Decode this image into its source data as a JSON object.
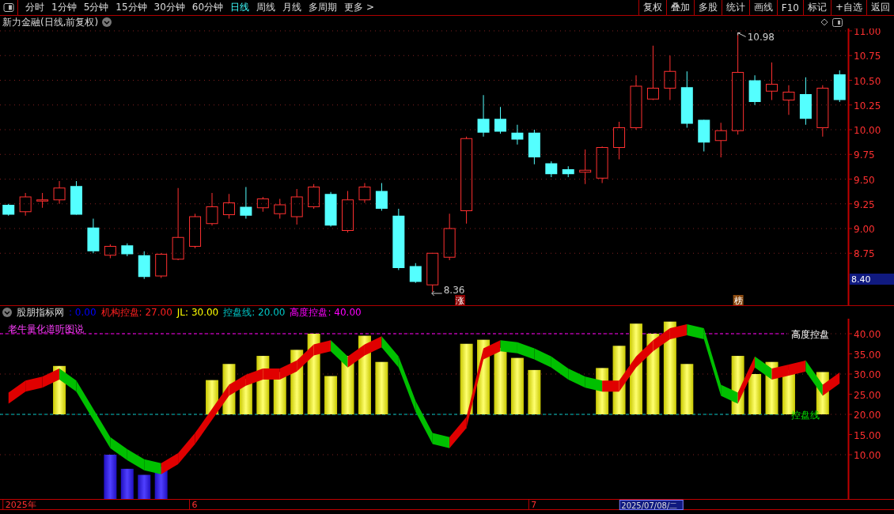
{
  "toolbar": {
    "periods": [
      {
        "label": "分时",
        "selected": false
      },
      {
        "label": "1分钟",
        "selected": false
      },
      {
        "label": "5分钟",
        "selected": false
      },
      {
        "label": "15分钟",
        "selected": false
      },
      {
        "label": "30分钟",
        "selected": false
      },
      {
        "label": "60分钟",
        "selected": false
      },
      {
        "label": "日线",
        "selected": true
      },
      {
        "label": "周线",
        "selected": false
      },
      {
        "label": "月线",
        "selected": false
      },
      {
        "label": "多周期",
        "selected": false
      },
      {
        "label": "更多 >",
        "selected": false
      }
    ],
    "buttons": [
      "复权",
      "叠加",
      "多股",
      "统计",
      "画线",
      "F10",
      "标记",
      "+自选",
      "返回"
    ]
  },
  "price_panel": {
    "title": "新力金融(日线,前复权)",
    "cursor_price": "8.40",
    "high_label": "10.98",
    "low_label": "8.36",
    "badges": [
      {
        "text": "涨",
        "color": "#8a0000"
      },
      {
        "text": "榜",
        "color": "#8a4a10"
      }
    ],
    "chart_data": {
      "type": "candlestick",
      "ylim": [
        8.224,
        11.024
      ],
      "grid": true,
      "yticks": [
        {
          "value": 11,
          "label": "11.00"
        },
        {
          "value": 10.75,
          "label": "10.75"
        },
        {
          "value": 10.5,
          "label": "10.50"
        },
        {
          "value": 10.25,
          "label": "10.25"
        },
        {
          "value": 10,
          "label": "10.00"
        },
        {
          "value": 9.75,
          "label": "9.75"
        },
        {
          "value": 9.5,
          "label": "9.50"
        },
        {
          "value": 9.25,
          "label": "9.25"
        },
        {
          "value": 9,
          "label": "9.00"
        },
        {
          "value": 8.75,
          "label": "8.75"
        }
      ],
      "ohlc": [
        [
          9.24,
          9.25,
          9.13,
          9.14
        ],
        [
          9.17,
          9.36,
          9.13,
          9.32
        ],
        [
          9.29,
          9.36,
          9.21,
          9.29
        ],
        [
          9.29,
          9.48,
          9.25,
          9.41
        ],
        [
          9.43,
          9.48,
          9.14,
          9.14
        ],
        [
          9.01,
          9.1,
          8.75,
          8.77
        ],
        [
          8.73,
          8.84,
          8.7,
          8.82
        ],
        [
          8.83,
          8.85,
          8.72,
          8.74
        ],
        [
          8.73,
          8.77,
          8.49,
          8.51
        ],
        [
          8.52,
          8.75,
          8.5,
          8.74
        ],
        [
          8.69,
          9.41,
          8.68,
          8.91
        ],
        [
          8.82,
          9.15,
          8.8,
          9.12
        ],
        [
          9.05,
          9.36,
          9.03,
          9.22
        ],
        [
          9.14,
          9.35,
          9.1,
          9.26
        ],
        [
          9.22,
          9.42,
          9.1,
          9.13
        ],
        [
          9.21,
          9.32,
          9.17,
          9.3
        ],
        [
          9.15,
          9.3,
          9.1,
          9.24
        ],
        [
          9.12,
          9.4,
          9.04,
          9.32
        ],
        [
          9.22,
          9.45,
          9.2,
          9.42
        ],
        [
          9.35,
          9.37,
          9.02,
          9.03
        ],
        [
          8.98,
          9.38,
          8.96,
          9.29
        ],
        [
          9.29,
          9.46,
          9.26,
          9.42
        ],
        [
          9.38,
          9.46,
          9.18,
          9.2
        ],
        [
          9.13,
          9.2,
          8.58,
          8.6
        ],
        [
          8.62,
          8.65,
          8.45,
          8.46
        ],
        [
          8.43,
          8.75,
          8.36,
          8.75
        ],
        [
          8.71,
          9.15,
          8.68,
          9.0
        ],
        [
          9.18,
          9.93,
          9.05,
          9.91
        ],
        [
          10.11,
          10.35,
          9.93,
          9.97
        ],
        [
          10.11,
          10.23,
          9.96,
          9.98
        ],
        [
          9.97,
          10.05,
          9.85,
          9.9
        ],
        [
          9.97,
          10.0,
          9.65,
          9.72
        ],
        [
          9.66,
          9.68,
          9.52,
          9.55
        ],
        [
          9.6,
          9.63,
          9.52,
          9.55
        ],
        [
          9.57,
          9.8,
          9.45,
          9.59
        ],
        [
          9.51,
          9.83,
          9.46,
          9.82
        ],
        [
          9.82,
          10.08,
          9.7,
          10.02
        ],
        [
          10.02,
          10.55,
          10.0,
          10.44
        ],
        [
          10.31,
          10.85,
          10.3,
          10.42
        ],
        [
          10.42,
          10.75,
          10.3,
          10.59
        ],
        [
          10.43,
          10.59,
          10.02,
          10.06
        ],
        [
          10.1,
          10.1,
          9.78,
          9.87
        ],
        [
          9.89,
          10.07,
          9.72,
          9.99
        ],
        [
          9.99,
          10.98,
          9.95,
          10.58
        ],
        [
          10.5,
          10.55,
          10.25,
          10.28
        ],
        [
          10.39,
          10.68,
          10.3,
          10.46
        ],
        [
          10.3,
          10.45,
          10.15,
          10.38
        ],
        [
          10.36,
          10.53,
          10.05,
          10.11
        ],
        [
          10.02,
          10.45,
          9.93,
          10.42
        ],
        [
          10.56,
          10.6,
          10.28,
          10.3
        ]
      ]
    }
  },
  "indicator_panel": {
    "title": "股朋指标网",
    "subtitle": "老牛量化道听图说",
    "legend": [
      {
        "text": ": 0.00",
        "color": "#0000ff"
      },
      {
        "text": "机构控盘: 27.00",
        "color": "#ff2020"
      },
      {
        "text": "JL: 30.00",
        "color": "#ffff00"
      },
      {
        "text": "控盘线: 20.00",
        "color": "#00c8c8"
      },
      {
        "text": "高度控盘: 40.00",
        "color": "#ff00ff"
      }
    ],
    "line_labels": [
      "高度控盘",
      "控盘线"
    ],
    "axis_labels": [
      "40.00",
      "35.00",
      "30.00",
      "25.00",
      "20.00",
      "15.00",
      "10.00"
    ],
    "date_labels": [
      "2025年",
      "6",
      "7"
    ],
    "cursor_date": "2025/07/08/二"
  }
}
